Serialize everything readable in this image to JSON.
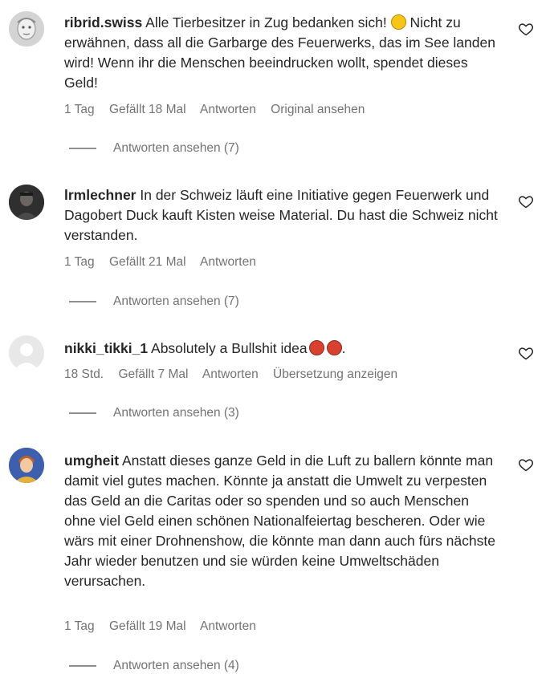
{
  "comments": [
    {
      "username": "ribrid.swiss",
      "text_before_emoji": "Alle Tierbesitzer in Zug bedanken sich! ",
      "emoji": "slightly-frowning-face-emoji",
      "text_after_emoji": " Nicht zu erwähnen, dass all die Garbarge des Feuerwerks, das im See landen wird! Wenn ihr die Menschen beeindrucken wollt, spendet dieses Geld!",
      "time": "1 Tag",
      "likes": "Gefällt 18 Mal",
      "reply_label": "Antworten",
      "extra_action": "Original ansehen",
      "view_replies": "Antworten ansehen (7)",
      "avatar_icon": "grey-face-avatar"
    },
    {
      "username": "lrmlechner",
      "text": "In der Schweiz läuft eine Initiative gegen Feuerwerk und Dagobert Duck kauft Kisten weise Material. Du hast die Schweiz nicht verstanden.",
      "time": "1 Tag",
      "likes": "Gefällt 21 Mal",
      "reply_label": "Antworten",
      "view_replies": "Antworten ansehen (7)",
      "avatar_icon": "dark-photo-avatar"
    },
    {
      "username": "nikki_tikki_1",
      "text": "Absolutely a Bullshit idea",
      "emoji": "cursing-face-emoji",
      "text_end": ".",
      "time": "18 Std.",
      "likes": "Gefällt 7 Mal",
      "reply_label": "Antworten",
      "extra_action": "Übersetzung anzeigen",
      "view_replies": "Antworten ansehen (3)",
      "avatar_icon": "default-user-avatar"
    },
    {
      "username": "umgheit",
      "text": "Anstatt dieses ganze Geld in die Luft zu ballern könnte man damit viel gutes machen. Könnte ja anstatt die Umwelt zu verpesten das Geld an die Caritas oder so spenden und so auch Menschen ohne viel Geld einen schönen Nationalfeiertag bescheren. Oder wie wärs mit einer Drohnenshow, die könnte man dann auch fürs nächste Jahr wieder benutzen und sie würden keine Umweltschäden verursachen.",
      "time": "1 Tag",
      "likes": "Gefällt 19 Mal",
      "reply_label": "Antworten",
      "view_replies": "Antworten ansehen (4)",
      "avatar_icon": "cartoon-avatar"
    }
  ],
  "colors": {
    "text": "#262626",
    "secondary": "#737373",
    "emoji_red": "#d8402f",
    "emoji_yellow": "#f5c518"
  }
}
